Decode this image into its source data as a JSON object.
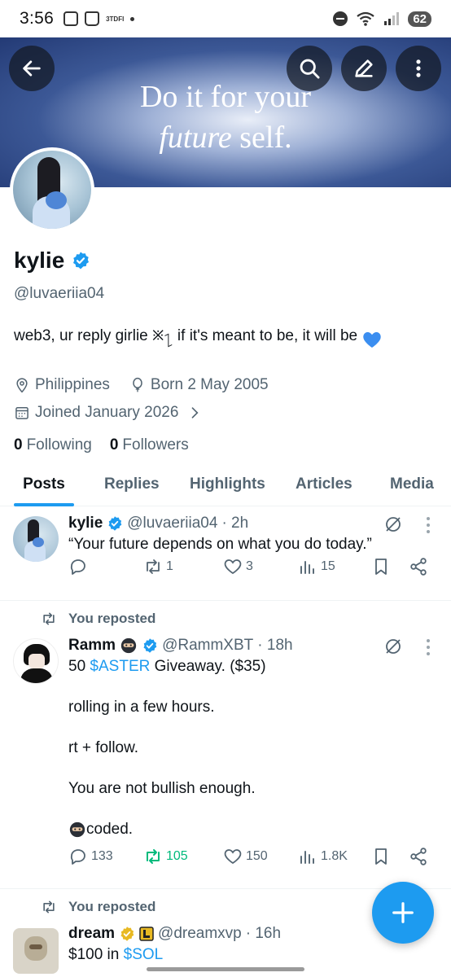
{
  "status": {
    "time": "3:56",
    "small_label": "3TDFI",
    "battery": "62"
  },
  "banner": {
    "line1": "Do it for your",
    "line2_italic": "future",
    "line2_rest": " self.",
    "icons": [
      "back-arrow-icon",
      "search-icon",
      "edit-icon",
      "more-vertical-icon"
    ]
  },
  "profile": {
    "name": "kylie",
    "handle": "@luvaeriia04",
    "bio_text": "web3, ur reply girlie ྿႑ if it's meant to be, it will be",
    "location": "Philippines",
    "born": "Born 2 May 2005",
    "joined": "Joined January 2026",
    "following_count": "0",
    "following_label": "Following",
    "followers_count": "0",
    "followers_label": "Followers"
  },
  "tabs": [
    "Posts",
    "Replies",
    "Highlights",
    "Articles",
    "Media"
  ],
  "tweets": [
    {
      "name": "kylie",
      "handle": "@luvaeriia04",
      "time": "· 2h",
      "text": "“Your future depends on what you do today.”",
      "reposts": "1",
      "likes": "3",
      "views": "15"
    },
    {
      "repost_label": "You reposted",
      "name": "Ramm",
      "handle": "@RammXBT",
      "time": "· 18h",
      "line1_prefix": "50 ",
      "line1_tag": "$ASTER",
      "line1_suffix": " Giveaway. ($35)",
      "line2": "rolling in a few hours.",
      "line3": "rt + follow.",
      "line4": "You are not bullish enough.",
      "line5": "coded.",
      "replies": "133",
      "reposts": "105",
      "likes": "150",
      "views": "1.8K"
    },
    {
      "repost_label": "You reposted",
      "name": "dream",
      "handle": "@dreamxvp",
      "time": "· 16h",
      "text_prefix": "$100 in ",
      "text_tag": "$SOL"
    }
  ],
  "colors": {
    "accent": "#1d9bf0",
    "repost_green": "#00ba7c",
    "muted": "#536471",
    "gold_badge": "#e8b923"
  }
}
